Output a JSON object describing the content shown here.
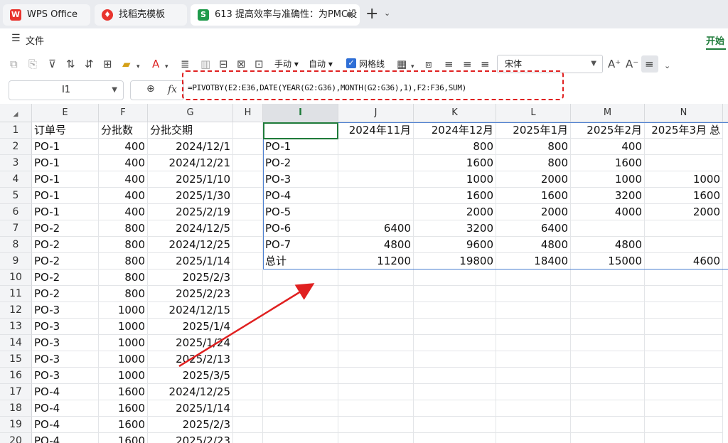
{
  "tabs": [
    {
      "label": "WPS Office",
      "icon": "W"
    },
    {
      "label": "找稻壳模板",
      "icon": "♦"
    },
    {
      "label": "613 提高效率与准确性：为PMC设",
      "icon": "S",
      "unsaved_dot": "●"
    }
  ],
  "tab_add": "+",
  "tab_more": "⌄",
  "menu": {
    "hamburger": "☰",
    "file": "文件",
    "start": "开始"
  },
  "toolbar": {
    "manual_label": "手动",
    "auto_label": "自动",
    "gridlines_label": "网格线",
    "gridlines_checked": "✓",
    "font_name": "宋体"
  },
  "formula_bar": {
    "name_box": "I1",
    "formula": "=PIVOTBY(E2:E36,DATE(YEAR(G2:G36),MONTH(G2:G36),1),F2:F36,SUM)"
  },
  "columns": [
    "E",
    "F",
    "G",
    "H",
    "I",
    "J",
    "K",
    "L",
    "M",
    "N"
  ],
  "rows": [
    "1",
    "2",
    "3",
    "4",
    "5",
    "6",
    "7",
    "8",
    "9",
    "10",
    "11",
    "12",
    "13",
    "14",
    "15",
    "16",
    "17",
    "18",
    "19",
    "20"
  ],
  "source_table": {
    "headers": [
      "订单号",
      "分批数",
      "分批交期"
    ],
    "rows": [
      [
        "PO-1",
        "400",
        "2024/12/1"
      ],
      [
        "PO-1",
        "400",
        "2024/12/21"
      ],
      [
        "PO-1",
        "400",
        "2025/1/10"
      ],
      [
        "PO-1",
        "400",
        "2025/1/30"
      ],
      [
        "PO-1",
        "400",
        "2025/2/19"
      ],
      [
        "PO-2",
        "800",
        "2024/12/5"
      ],
      [
        "PO-2",
        "800",
        "2024/12/25"
      ],
      [
        "PO-2",
        "800",
        "2025/1/14"
      ],
      [
        "PO-2",
        "800",
        "2025/2/3"
      ],
      [
        "PO-2",
        "800",
        "2025/2/23"
      ],
      [
        "PO-3",
        "1000",
        "2024/12/15"
      ],
      [
        "PO-3",
        "1000",
        "2025/1/4"
      ],
      [
        "PO-3",
        "1000",
        "2025/1/24"
      ],
      [
        "PO-3",
        "1000",
        "2025/2/13"
      ],
      [
        "PO-3",
        "1000",
        "2025/3/5"
      ],
      [
        "PO-4",
        "1600",
        "2024/12/25"
      ],
      [
        "PO-4",
        "1600",
        "2025/1/14"
      ],
      [
        "PO-4",
        "1600",
        "2025/2/3"
      ],
      [
        "PO-4",
        "1600",
        "2025/2/23"
      ]
    ]
  },
  "pivot": {
    "headers": [
      "",
      "2024年11月",
      "2024年12月",
      "2025年1月",
      "2025年2月",
      "2025年3月"
    ],
    "header_overflow": "总",
    "rows": [
      [
        "PO-1",
        "",
        "800",
        "800",
        "400",
        ""
      ],
      [
        "PO-2",
        "",
        "1600",
        "800",
        "1600",
        ""
      ],
      [
        "PO-3",
        "",
        "1000",
        "2000",
        "1000",
        "1000"
      ],
      [
        "PO-4",
        "",
        "1600",
        "1600",
        "3200",
        "1600"
      ],
      [
        "PO-5",
        "",
        "2000",
        "2000",
        "4000",
        "2000"
      ],
      [
        "PO-6",
        "6400",
        "3200",
        "6400",
        "",
        ""
      ],
      [
        "PO-7",
        "4800",
        "9600",
        "4800",
        "4800",
        ""
      ],
      [
        "总计",
        "11200",
        "19800",
        "18400",
        "15000",
        "4600"
      ]
    ]
  },
  "colors": {
    "accent": "#1f7b3a",
    "highlight": "#e02020",
    "pivot_border": "#4b7fd1"
  }
}
